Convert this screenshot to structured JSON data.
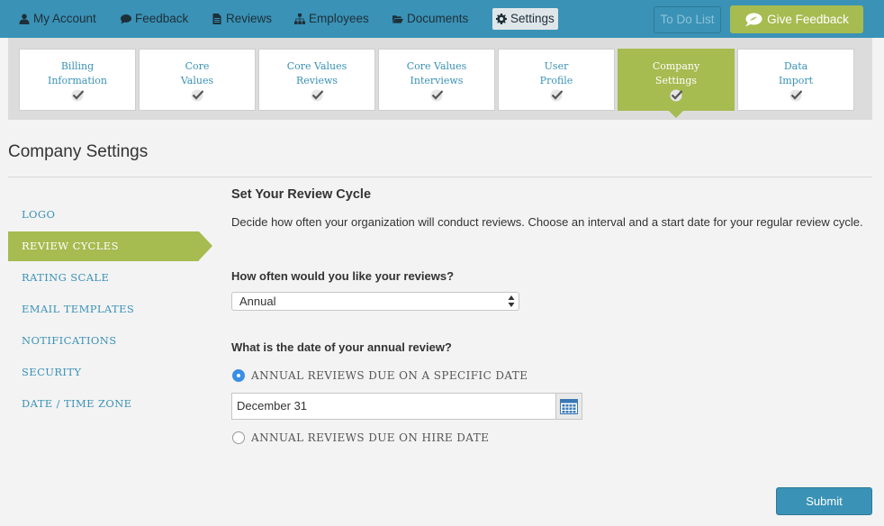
{
  "nav": {
    "items": [
      {
        "label": "My Account",
        "icon": "user-icon"
      },
      {
        "label": "Feedback",
        "icon": "comment-icon"
      },
      {
        "label": "Reviews",
        "icon": "file-icon"
      },
      {
        "label": "Employees",
        "icon": "sitemap-icon"
      },
      {
        "label": "Documents",
        "icon": "folder-open-icon"
      },
      {
        "label": "Settings",
        "icon": "gear-icon",
        "active": true
      }
    ],
    "todo_label": "To Do List",
    "feedback_btn_label": "Give Feedback"
  },
  "wizard": {
    "steps": [
      {
        "label": "Billing\nInformation",
        "done": true
      },
      {
        "label": "Core\nValues",
        "done": true
      },
      {
        "label": "Core Values\nReviews",
        "done": true
      },
      {
        "label": "Core Values\nInterviews",
        "done": true
      },
      {
        "label": "User\nProfile",
        "done": true
      },
      {
        "label": "Company\nSettings",
        "done": true,
        "active": true
      },
      {
        "label": "Data\nImport",
        "done": true
      }
    ]
  },
  "page": {
    "title": "Company Settings"
  },
  "sidebar": {
    "items": [
      {
        "label": "LOGO"
      },
      {
        "label": "REVIEW CYCLES",
        "active": true
      },
      {
        "label": "RATING SCALE"
      },
      {
        "label": "EMAIL TEMPLATES"
      },
      {
        "label": "NOTIFICATIONS"
      },
      {
        "label": "SECURITY"
      },
      {
        "label": "DATE / TIME ZONE"
      }
    ]
  },
  "main": {
    "section_title": "Set Your Review Cycle",
    "description": "Decide how often your organization will conduct reviews. Choose an interval and a start date for your regular review cycle.",
    "frequency_question": "How often would you like your reviews?",
    "frequency_value": "Annual",
    "date_question": "What is the date of your annual review?",
    "option_specific": "ANNUAL REVIEWS DUE ON A SPECIFIC DATE",
    "option_specific_selected": true,
    "date_value": "December 31",
    "option_hire": "ANNUAL REVIEWS DUE ON HIRE DATE",
    "submit_label": "Submit"
  },
  "colors": {
    "nav_bg": "#3a92b6",
    "accent_green": "#a6bb50",
    "link_blue": "#3a92b6",
    "radio_selected": "#3a8ee6"
  }
}
